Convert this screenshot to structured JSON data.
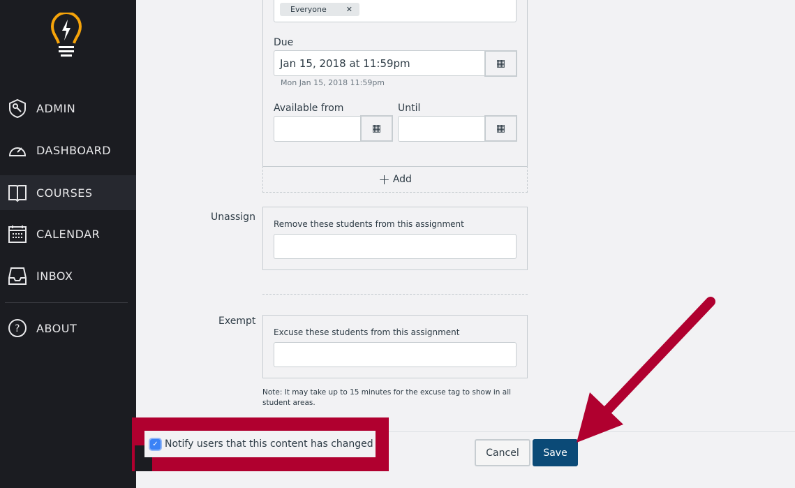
{
  "sidebar": {
    "items": [
      {
        "label": "ADMIN",
        "icon": "shield-key-icon"
      },
      {
        "label": "DASHBOARD",
        "icon": "speedometer-icon"
      },
      {
        "label": "COURSES",
        "icon": "book-icon",
        "active": true
      },
      {
        "label": "CALENDAR",
        "icon": "calendar-icon"
      },
      {
        "label": "INBOX",
        "icon": "inbox-icon"
      },
      {
        "label": "ABOUT",
        "icon": "question-icon"
      }
    ]
  },
  "assign": {
    "tag": "Everyone",
    "due_label": "Due",
    "due_value": "Jan 15, 2018 at 11:59pm",
    "due_hint": "Mon Jan 15, 2018 11:59pm",
    "available_label": "Available from",
    "until_label": "Until",
    "add_label": "Add"
  },
  "unassign": {
    "label": "Unassign",
    "hint": "Remove these students from this assignment"
  },
  "exempt": {
    "label": "Exempt",
    "hint": "Excuse these students from this assignment",
    "note": "Note: It may take up to 15 minutes for the excuse tag to show in all student areas."
  },
  "footer": {
    "notify_label": "Notify users that this content has changed",
    "notify_checked": true,
    "cancel": "Cancel",
    "save": "Save"
  },
  "colors": {
    "sidebar": "#1b1c21",
    "accent": "#0b4a77",
    "annotation": "#b0002f",
    "logo": "#f5a30a"
  }
}
